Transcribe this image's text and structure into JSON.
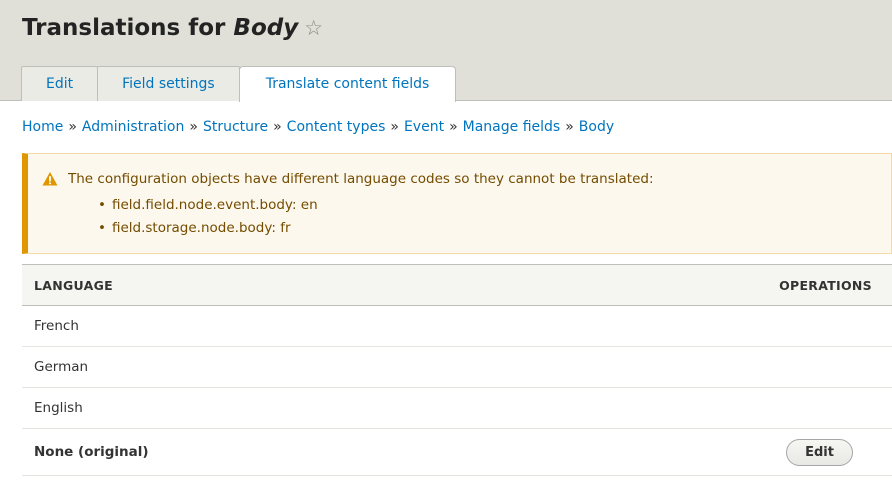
{
  "title": {
    "prefix": "Translations for",
    "entity": "Body",
    "star": "☆"
  },
  "tabs": [
    {
      "label": "Edit",
      "active": false
    },
    {
      "label": "Field settings",
      "active": false
    },
    {
      "label": "Translate content fields",
      "active": true
    }
  ],
  "breadcrumb": {
    "separator": "»",
    "items": [
      "Home",
      "Administration",
      "Structure",
      "Content types",
      "Event",
      "Manage fields",
      "Body"
    ]
  },
  "warning": {
    "icon": "warning-icon",
    "message": "The configuration objects have different language codes so they cannot be translated:",
    "items": [
      "field.field.node.event.body: en",
      "field.storage.node.body: fr"
    ],
    "color": "#e09600"
  },
  "table": {
    "headers": {
      "language": "LANGUAGE",
      "operations": "OPERATIONS"
    },
    "rows": [
      {
        "language": "French",
        "operation": ""
      },
      {
        "language": "German",
        "operation": ""
      },
      {
        "language": "English",
        "operation": ""
      },
      {
        "language": "None (original)",
        "operation": "Edit"
      }
    ]
  },
  "colors": {
    "link": "#0074bd",
    "header_bg": "#e0e0d8",
    "warning_bg": "#fdf8ed"
  }
}
